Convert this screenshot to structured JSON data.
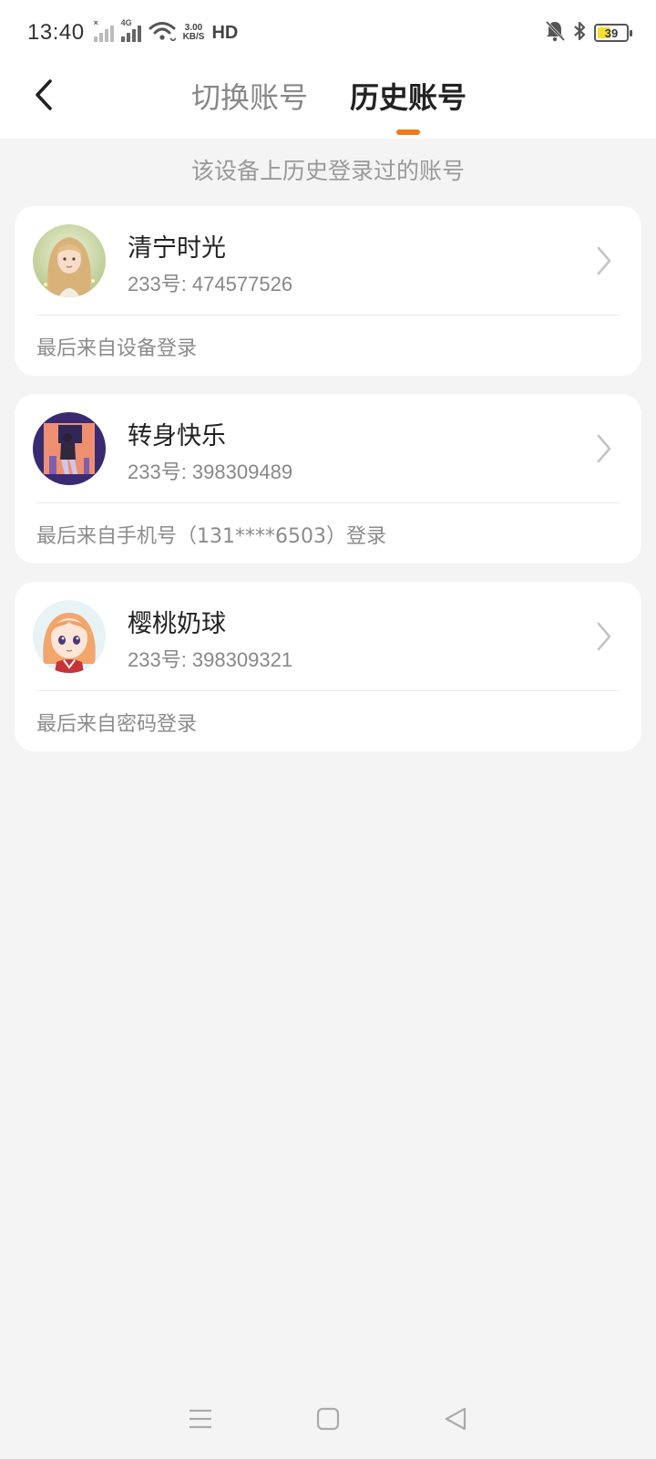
{
  "status_bar": {
    "time": "13:40",
    "signal1_label": "×",
    "signal2_label": "4G",
    "speed_value": "3.00",
    "speed_unit": "KB/S",
    "hd": "HD",
    "battery": "39",
    "icons": [
      "signal-icon",
      "wifi-icon",
      "mute-bell-icon",
      "bluetooth-icon",
      "battery-icon"
    ]
  },
  "header": {
    "back_icon": "chevron-left-icon",
    "tabs": [
      {
        "label": "切换账号",
        "active": false
      },
      {
        "label": "历史账号",
        "active": true
      }
    ],
    "accent_color": "#f07a1a"
  },
  "subtitle": "该设备上历史登录过的账号",
  "accounts": [
    {
      "name": "清宁时光",
      "uid": "233号: 474577526",
      "last_login": "最后来自设备登录",
      "avatar": "avatar-girl-blonde"
    },
    {
      "name": "转身快乐",
      "uid": "233号: 398309489",
      "last_login": "最后来自手机号（131****6503）登录",
      "avatar": "avatar-figure-purple"
    },
    {
      "name": "樱桃奶球",
      "uid": "233号: 398309321",
      "last_login": "最后来自密码登录",
      "avatar": "avatar-anime-girl"
    }
  ],
  "nav_bar": {
    "icons": [
      "menu-icon",
      "home-square-icon",
      "back-triangle-icon"
    ]
  }
}
